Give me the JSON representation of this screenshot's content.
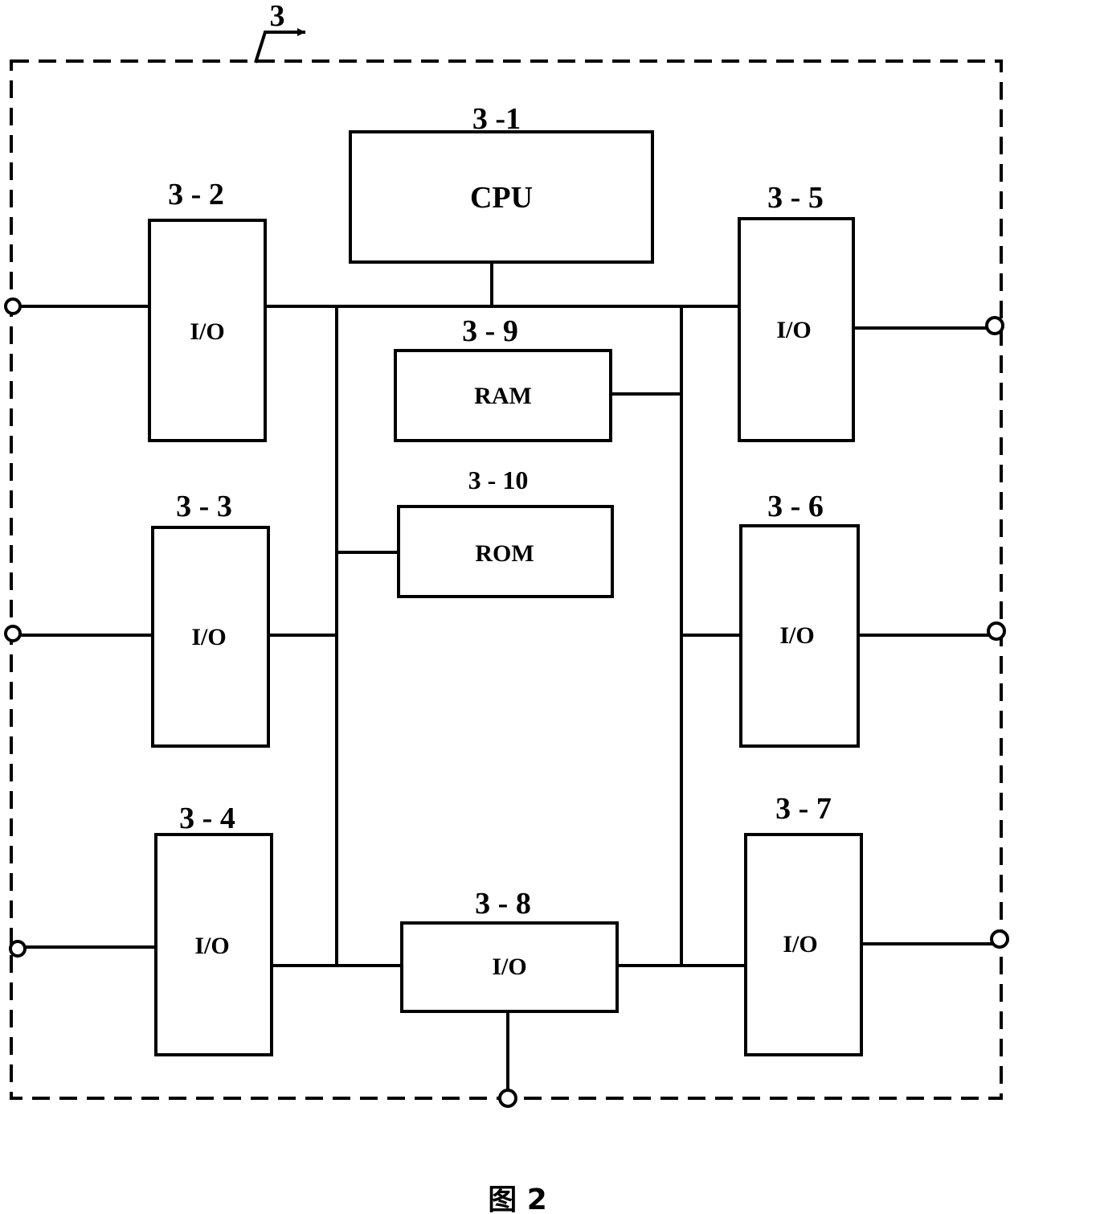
{
  "diagram": {
    "caption": "图 2",
    "system": {
      "label": "3"
    },
    "blocks": [
      {
        "id": "3-1",
        "number": "3 -1",
        "label": "CPU"
      },
      {
        "id": "3-2",
        "number": "3 - 2",
        "label": "I/O"
      },
      {
        "id": "3-3",
        "number": "3 - 3",
        "label": "I/O"
      },
      {
        "id": "3-4",
        "number": "3 - 4",
        "label": "I/O"
      },
      {
        "id": "3-5",
        "number": "3 - 5",
        "label": "I/O"
      },
      {
        "id": "3-6",
        "number": "3 - 6",
        "label": "I/O"
      },
      {
        "id": "3-7",
        "number": "3 - 7",
        "label": "I/O"
      },
      {
        "id": "3-8",
        "number": "3 - 8",
        "label": "I/O"
      },
      {
        "id": "3-9",
        "number": "3 - 9",
        "label": "RAM"
      },
      {
        "id": "3-10",
        "number": "3 - 10",
        "label": "ROM"
      }
    ],
    "connections": [
      "3-1 to bus",
      "3-2 to bus",
      "3-5 to bus",
      "3-9 to right bus",
      "3-10 to left bus",
      "3-3 to left bus",
      "3-6 to right bus",
      "3-4 to 3-8",
      "3-8 to 3-7",
      "3-8 to bottom terminal"
    ]
  }
}
